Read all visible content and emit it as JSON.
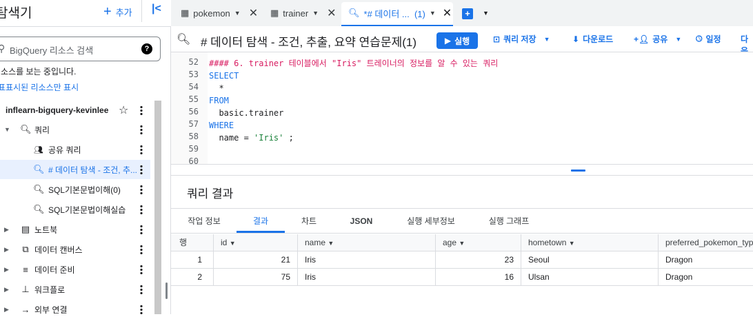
{
  "sidebar": {
    "title": "탐색기",
    "add_label": "추가",
    "search_placeholder": "BigQuery 리소스 검색",
    "status_text": "리소스를 보는 중입니다.",
    "starred_link": "별표표시된 리소스만 표시",
    "project": "inflearn-bigquery-kevinlee",
    "items": [
      {
        "label": "쿼리",
        "icon": "query-icon",
        "expanded": true
      },
      {
        "label": "공유 쿼리",
        "icon": "people-icon"
      },
      {
        "label": "# 데이터 탐색 - 조건, 추...",
        "icon": "query-icon",
        "selected": true
      },
      {
        "label": "SQL기본문법이해(0)",
        "icon": "query-icon"
      },
      {
        "label": "SQL기본문법이해실습",
        "icon": "query-icon"
      },
      {
        "label": "노트북",
        "icon": "notebook-icon"
      },
      {
        "label": "데이터 캔버스",
        "icon": "canvas-icon"
      },
      {
        "label": "데이터 준비",
        "icon": "data-prep-icon"
      },
      {
        "label": "워크플로",
        "icon": "workflow-icon"
      },
      {
        "label": "외부 연결",
        "icon": "connection-icon"
      }
    ]
  },
  "tabs": [
    {
      "label": "pokemon",
      "icon": "table-icon"
    },
    {
      "label": "trainer",
      "icon": "table-icon"
    },
    {
      "label": "*# 데이터 ...  (1)",
      "icon": "query-icon",
      "active": true
    }
  ],
  "toolbar": {
    "query_title": "# 데이터 탐색 - 조건, 추출, 요약 연습문제(1)",
    "run": "실행",
    "save": "쿼리 저장",
    "download": "다운로드",
    "share": "공유",
    "schedule": "일정",
    "more": "다음"
  },
  "editor": {
    "lines": [
      {
        "n": "52",
        "text": "#### 6. trainer 테이블에서 \"Iris\" 트레이너의 정보를 알 수 있는 쿼리"
      },
      {
        "n": "53",
        "text": "SELECT"
      },
      {
        "n": "54",
        "text": "  *"
      },
      {
        "n": "55",
        "text": "FROM"
      },
      {
        "n": "56",
        "text": "  basic.trainer"
      },
      {
        "n": "57",
        "text": "WHERE"
      },
      {
        "n": "58",
        "pre": "  name = ",
        "str": "'Iris'",
        "post": " ;"
      },
      {
        "n": "59",
        "text": ""
      },
      {
        "n": "60",
        "text": ""
      }
    ]
  },
  "results": {
    "title": "쿼리 결과",
    "tabs": [
      "작업 정보",
      "결과",
      "차트",
      "JSON",
      "실행 세부정보",
      "실행 그래프"
    ],
    "active_tab": "결과",
    "columns": [
      "행",
      "id",
      "name",
      "age",
      "hometown",
      "preferred_pokemon_typ"
    ],
    "rows": [
      [
        "1",
        "21",
        "Iris",
        "23",
        "Seoul",
        "Dragon"
      ],
      [
        "2",
        "75",
        "Iris",
        "16",
        "Ulsan",
        "Dragon"
      ]
    ]
  },
  "colors": {
    "accent": "#1a73e8",
    "comment": "#d81b60",
    "string": "#188038",
    "selected_bg": "#e8f0fe"
  }
}
